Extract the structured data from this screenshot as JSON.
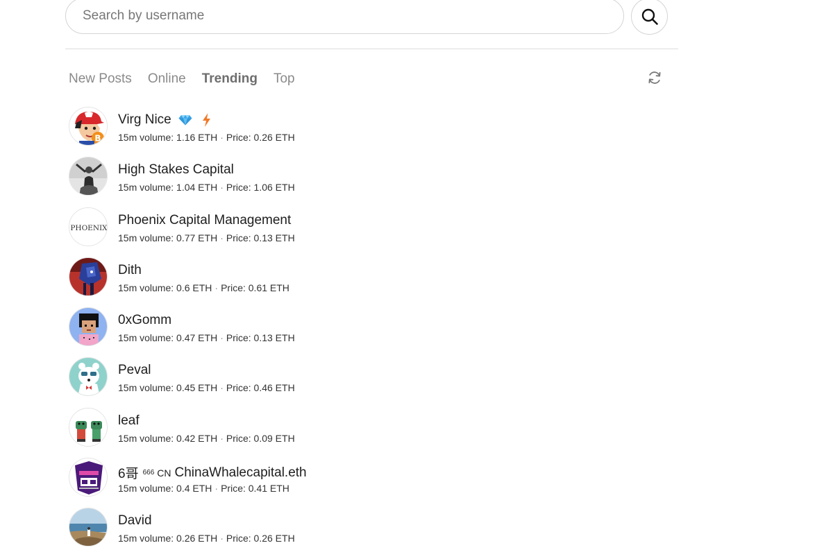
{
  "search": {
    "placeholder": "Search by username",
    "button_icon": "search-icon"
  },
  "tabs": [
    {
      "label": "New Posts",
      "active": false
    },
    {
      "label": "Online",
      "active": false
    },
    {
      "label": "Trending",
      "active": true
    },
    {
      "label": "Top",
      "active": false
    }
  ],
  "refresh_icon": "refresh-icon",
  "stat_labels": {
    "volume": "15m volume:",
    "price": "Price:",
    "separator": "·"
  },
  "users": [
    {
      "name": "Virg Nice",
      "volume": "1.16 ETH",
      "price": "0.26 ETH",
      "badges": [
        "diamond-icon",
        "lightning-icon"
      ],
      "avatar": "cartoon-trainer"
    },
    {
      "name": "High Stakes Capital",
      "volume": "1.04 ETH",
      "price": "1.06 ETH",
      "badges": [],
      "avatar": "grayscale-figure"
    },
    {
      "name": "Phoenix Capital Management",
      "volume": "0.77 ETH",
      "price": "0.13 ETH",
      "badges": [],
      "avatar": "phoenix-logo",
      "avatar_text": "PHOENIX"
    },
    {
      "name": "Dith",
      "volume": "0.6 ETH",
      "price": "0.61 ETH",
      "badges": [],
      "avatar": "blue-red-robot"
    },
    {
      "name": "0xGomm",
      "volume": "0.47 ETH",
      "price": "0.13 ETH",
      "badges": [],
      "avatar": "pixel-afro"
    },
    {
      "name": "Peval",
      "volume": "0.45 ETH",
      "price": "0.46 ETH",
      "badges": [],
      "avatar": "polar-bear"
    },
    {
      "name": "leaf",
      "volume": "0.42 ETH",
      "price": "0.09 ETH",
      "badges": [],
      "avatar": "twin-frogs"
    },
    {
      "name_prefix": "6哥",
      "name_sup": "666",
      "name_cn": "CN",
      "name": "ChinaWhalecapital.eth",
      "volume": "0.4 ETH",
      "price": "0.41 ETH",
      "badges": [],
      "avatar": "whale-capital-logo"
    },
    {
      "name": "David",
      "volume": "0.26 ETH",
      "price": "0.26 ETH",
      "badges": [],
      "avatar": "seaside-photo"
    }
  ],
  "colors": {
    "diamond": "#3aa6e8",
    "lightning": "#f07a2a",
    "text": "#1e1e1e",
    "muted": "#8a8a8a",
    "border": "#d4d4d4"
  }
}
